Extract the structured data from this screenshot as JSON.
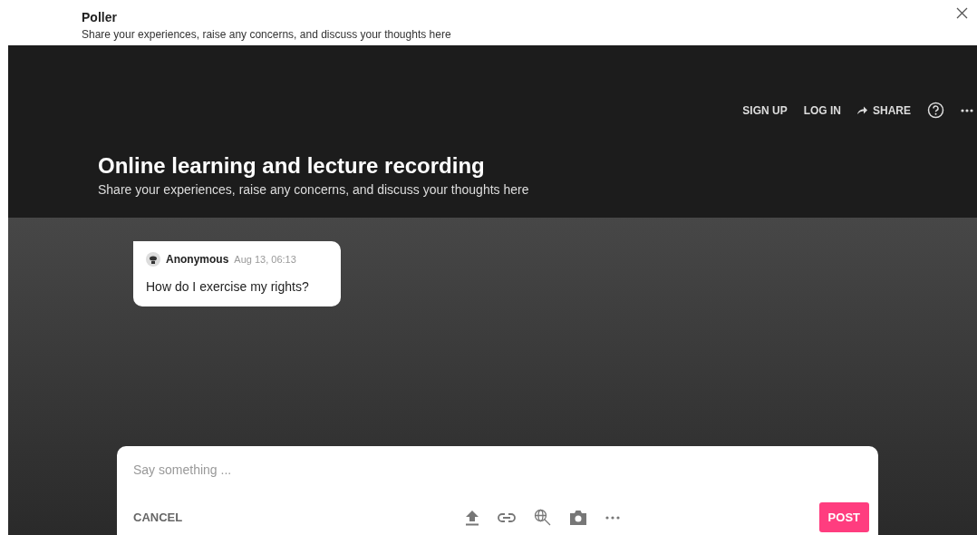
{
  "dialog": {
    "title": "Poller",
    "subtitle": "Share your experiences, raise any concerns, and discuss your thoughts here"
  },
  "nav": {
    "sign_up": "SIGN UP",
    "log_in": "LOG IN",
    "share": "SHARE"
  },
  "board": {
    "title": "Online learning and lecture recording",
    "description": "Share your experiences, raise any concerns, and discuss your thoughts here"
  },
  "posts": [
    {
      "author": "Anonymous",
      "time": "Aug 13, 06:13",
      "body": "How do I exercise my rights?"
    }
  ],
  "composer": {
    "placeholder": "Say something ...",
    "cancel": "CANCEL",
    "post": "POST"
  }
}
